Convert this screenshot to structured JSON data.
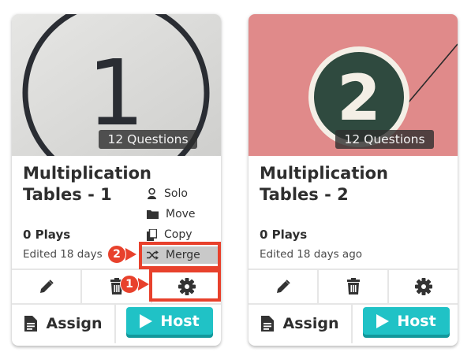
{
  "cards": [
    {
      "questions_badge": "12 Questions",
      "title": "Multiplication Tables - 1",
      "plays": "0 Plays",
      "edited": "Edited 18 days",
      "thumbnail_numeral": "1",
      "actions": {
        "assign_label": "Assign",
        "host_label": "Host"
      }
    },
    {
      "questions_badge": "12 Questions",
      "title": "Multiplication Tables - 2",
      "plays": "0 Plays",
      "edited": "Edited 18 days ago",
      "thumbnail_numeral": "2",
      "actions": {
        "assign_label": "Assign",
        "host_label": "Host"
      }
    }
  ],
  "menu": {
    "items": [
      {
        "label": "Solo",
        "icon": "solo-icon"
      },
      {
        "label": "Move",
        "icon": "folder-icon"
      },
      {
        "label": "Copy",
        "icon": "copy-icon"
      },
      {
        "label": "Merge",
        "icon": "shuffle-icon"
      }
    ]
  },
  "callouts": {
    "first": "1",
    "second": "2"
  },
  "colors": {
    "accent": "#20c2c6",
    "accent_shadow": "#12989b",
    "annotation": "#e8412c",
    "card2_background": "#e08a8a",
    "card2_circle": "#2f4a3f"
  },
  "icons": [
    "pencil-icon",
    "trash-icon",
    "gear-icon",
    "document-icon",
    "play-icon"
  ]
}
